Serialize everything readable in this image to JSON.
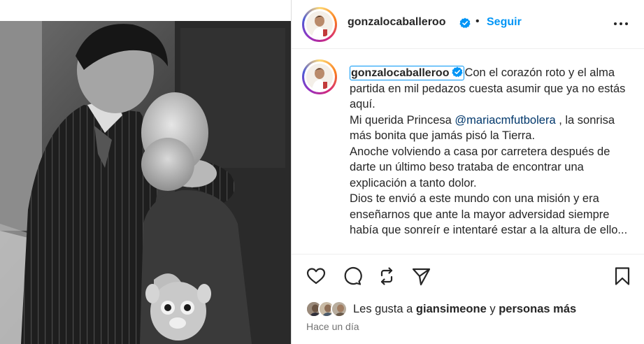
{
  "post": {
    "author": "gonzalocaballeroo",
    "follow_label": "Seguir",
    "separator": "•",
    "more_label": "•••"
  },
  "caption": {
    "username": "gonzalocaballeroo",
    "line1": "Con el corazón roto y el alma partida en mil pedazos cuesta asumir que ya no estás aquí.",
    "line2_pre": "Mi querida Princesa ",
    "mention": "@mariacmfutbolera",
    "line2_post": " , la sonrisa más bonita que jamás pisó la Tierra.",
    "line3": "Anoche volviendo a casa por carretera después de darte un último beso trataba de encontrar una explicación a tanto dolor.",
    "line4": "Dios te envió a este mundo con una misión y era enseñarnos que ante la mayor adversidad siempre había que sonreír e intentaré estar a la altura de ello..."
  },
  "likes": {
    "prefix": "Les gusta a ",
    "first_user": "giansimeone",
    "connector": " y ",
    "others": "personas más"
  },
  "timestamp": "Hace un día",
  "icons": {
    "like": "heart-icon",
    "comment": "comment-icon",
    "repost": "repost-icon",
    "share": "share-icon",
    "save": "bookmark-icon",
    "verified": "verified-badge-icon"
  },
  "colors": {
    "accent": "#0095f6",
    "mention": "#00376b",
    "text": "#262626",
    "muted": "#737373"
  }
}
